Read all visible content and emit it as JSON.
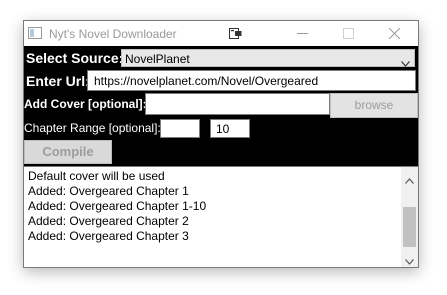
{
  "window": {
    "title": "Nyt's Novel Downloader"
  },
  "source": {
    "label": "Select Source:",
    "value": "NovelPlanet"
  },
  "url": {
    "label": "Enter Url:",
    "value": "https://novelplanet.com/Novel/Overgeared"
  },
  "cover": {
    "label": "Add Cover [optional]:",
    "value": "",
    "browse_label": "browse"
  },
  "range": {
    "label": "Chapter Range [optional]:",
    "from": "",
    "to": "10"
  },
  "compile_label": "Compile",
  "log": [
    "Default cover will be used",
    "Added: Overgeared Chapter 1",
    "Added: Overgeared Chapter 1-10",
    "Added: Overgeared Chapter 2",
    "Added: Overgeared Chapter 3"
  ],
  "colors": {
    "background": "#000000",
    "label": "#ffffff",
    "disabled_text": "#9d9d9d",
    "title_text": "#9a9a9a"
  },
  "icons": [
    "app-icon",
    "pin-icon",
    "minimize-icon",
    "maximize-icon",
    "close-icon",
    "chevron-down-icon",
    "scroll-up-icon",
    "scroll-down-icon"
  ]
}
